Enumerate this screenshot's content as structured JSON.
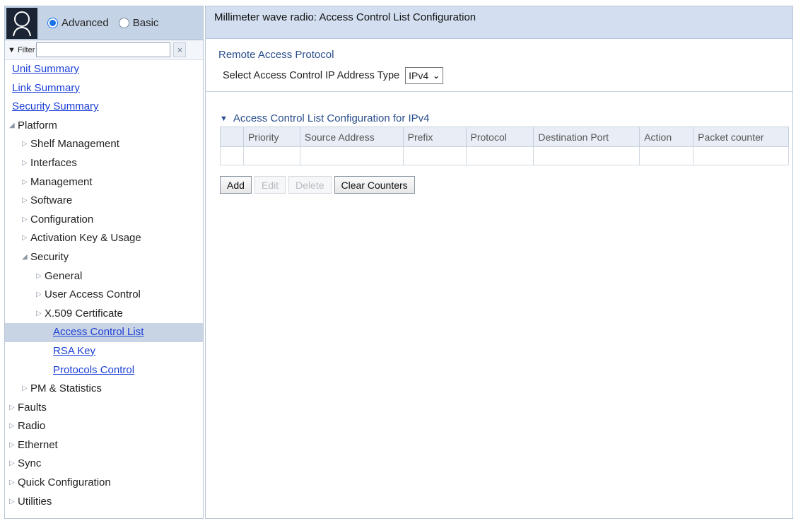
{
  "mode": {
    "advanced_label": "Advanced",
    "basic_label": "Basic",
    "selected": "Advanced"
  },
  "filter": {
    "label": "▼ Filter",
    "value": "",
    "clear_icon": "×"
  },
  "tree": [
    {
      "label": "Unit Summary",
      "depth": 0,
      "arrow": "",
      "link": true
    },
    {
      "label": "Link Summary",
      "depth": 0,
      "arrow": "",
      "link": true
    },
    {
      "label": "Security Summary",
      "depth": 0,
      "arrow": "",
      "link": true
    },
    {
      "label": "Platform",
      "depth": 0,
      "arrow": "expanded"
    },
    {
      "label": "Shelf Management",
      "depth": 1,
      "arrow": "collapsed"
    },
    {
      "label": "Interfaces",
      "depth": 1,
      "arrow": "collapsed"
    },
    {
      "label": "Management",
      "depth": 1,
      "arrow": "collapsed"
    },
    {
      "label": "Software",
      "depth": 1,
      "arrow": "collapsed"
    },
    {
      "label": "Configuration",
      "depth": 1,
      "arrow": "collapsed"
    },
    {
      "label": "Activation Key & Usage",
      "depth": 1,
      "arrow": "collapsed"
    },
    {
      "label": "Security",
      "depth": 1,
      "arrow": "expanded"
    },
    {
      "label": "General",
      "depth": 2,
      "arrow": "collapsed"
    },
    {
      "label": "User Access Control",
      "depth": 2,
      "arrow": "collapsed"
    },
    {
      "label": "X.509 Certificate",
      "depth": 2,
      "arrow": "collapsed"
    },
    {
      "label": "Access Control List",
      "depth": 3,
      "arrow": "",
      "link": true,
      "selected": true
    },
    {
      "label": "RSA Key",
      "depth": 3,
      "arrow": "",
      "link": true
    },
    {
      "label": "Protocols Control",
      "depth": 3,
      "arrow": "",
      "link": true
    },
    {
      "label": "PM & Statistics",
      "depth": 1,
      "arrow": "collapsed"
    },
    {
      "label": "Faults",
      "depth": 0,
      "arrow": "collapsed"
    },
    {
      "label": "Radio",
      "depth": 0,
      "arrow": "collapsed"
    },
    {
      "label": "Ethernet",
      "depth": 0,
      "arrow": "collapsed"
    },
    {
      "label": "Sync",
      "depth": 0,
      "arrow": "collapsed"
    },
    {
      "label": "Quick Configuration",
      "depth": 0,
      "arrow": "collapsed"
    },
    {
      "label": "Utilities",
      "depth": 0,
      "arrow": "collapsed"
    }
  ],
  "main": {
    "header": "Millimeter wave radio: Access Control List Configuration",
    "section_title": "Remote Access Protocol",
    "select_label": "Select Access Control IP Address Type",
    "select_value": "IPv4",
    "acl_title": "Access Control List Configuration for IPv4",
    "columns": [
      "",
      "Priority",
      "Source Address",
      "Prefix",
      "Protocol",
      "Destination Port",
      "Action",
      "Packet counter"
    ],
    "rows": [
      [
        "",
        "",
        "",
        "",
        "",
        "",
        "",
        ""
      ]
    ],
    "buttons": [
      {
        "label": "Add",
        "enabled": true
      },
      {
        "label": "Edit",
        "enabled": false
      },
      {
        "label": "Delete",
        "enabled": false
      },
      {
        "label": "Clear Counters",
        "enabled": true
      }
    ]
  },
  "colors": {
    "header_bg": "#d3dff0",
    "link": "#1a3ed6",
    "selected_bg": "#c8d4e4"
  }
}
